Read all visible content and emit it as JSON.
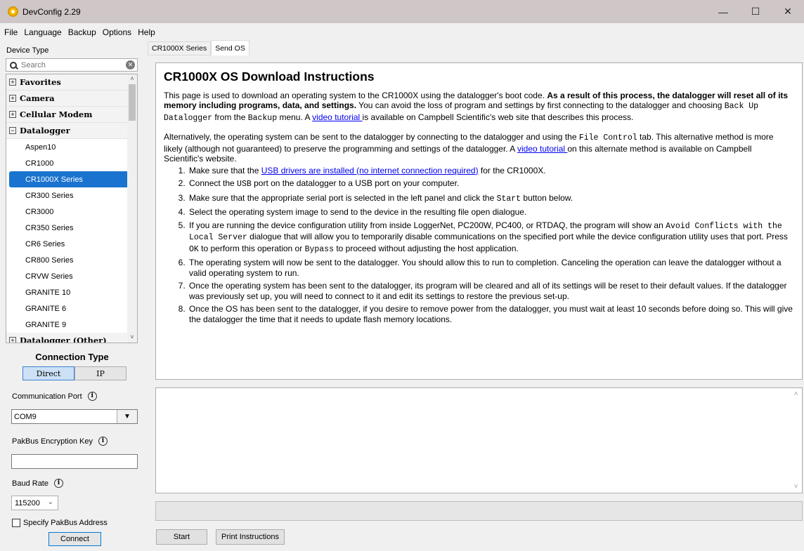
{
  "window": {
    "title": "DevConfig 2.29",
    "min": "—",
    "max": "☐",
    "close": "✕"
  },
  "menu": [
    "File",
    "Language",
    "Backup",
    "Options",
    "Help"
  ],
  "sidebar": {
    "device_type_label": "Device Type",
    "search_placeholder": "Search",
    "tree": [
      {
        "kind": "group",
        "label": "Favorites",
        "expanded": false
      },
      {
        "kind": "group",
        "label": "Camera",
        "expanded": false
      },
      {
        "kind": "group",
        "label": "Cellular Modem",
        "expanded": false
      },
      {
        "kind": "group",
        "label": "Datalogger",
        "expanded": true
      },
      {
        "kind": "child",
        "label": "Aspen10"
      },
      {
        "kind": "child",
        "label": "CR1000"
      },
      {
        "kind": "child",
        "label": "CR1000X Series",
        "selected": true
      },
      {
        "kind": "child",
        "label": "CR300 Series"
      },
      {
        "kind": "child",
        "label": "CR3000"
      },
      {
        "kind": "child",
        "label": "CR350 Series"
      },
      {
        "kind": "child",
        "label": "CR6 Series"
      },
      {
        "kind": "child",
        "label": "CR800 Series"
      },
      {
        "kind": "child",
        "label": "CRVW Series"
      },
      {
        "kind": "child",
        "label": "GRANITE 10"
      },
      {
        "kind": "child",
        "label": "GRANITE 6"
      },
      {
        "kind": "child",
        "label": "GRANITE 9"
      },
      {
        "kind": "group",
        "label": "Datalogger (Other)",
        "expanded": false
      }
    ],
    "connection_type_title": "Connection Type",
    "conn_direct": "Direct",
    "conn_ip": "IP",
    "comm_port_label": "Communication Port",
    "comm_port_value": "COM9",
    "pakbus_key_label": "PakBus Encryption Key",
    "pakbus_key_value": "",
    "baud_label": "Baud Rate",
    "baud_value": "115200",
    "specify_pakbus_label": "Specify PakBus Address",
    "connect_label": "Connect"
  },
  "tabs": [
    "CR1000X Series",
    "Send OS"
  ],
  "instructions": {
    "title": "CR1000X OS Download Instructions",
    "p1_a": "This page is used to download an operating system to the CR1000X using the datalogger's boot code. ",
    "p1_bold": "As a result of this process, the datalogger will reset all of its memory including programs, data, and settings.",
    "p1_b": " You can avoid the loss of program and settings by first connecting to the datalogger and choosing ",
    "p1_mono1": "Back Up Datalogger",
    "p1_c": " from the ",
    "p1_mono2": "Backup",
    "p1_d": " menu. A ",
    "p1_link": "video tutorial ",
    "p1_e": "is available on Campbell Scientific's web site that describes this process.",
    "p2_a": "Alternatively, the operating system can be sent to the datalogger by connecting to the datalogger and using the ",
    "p2_mono": "File Control",
    "p2_b": " tab. This alternative method is more likely (although not guaranteed) to preserve the programming and settings of the datalogger. A ",
    "p2_link": "video tutorial ",
    "p2_c": "on this alternate method is available on Campbell Scientific's website.",
    "s1_a": "Make sure that the ",
    "s1_link": "USB drivers are installed (no internet connection required)",
    "s1_b": " for the CR1000X.",
    "s2_a": "Connect the ",
    "s2_mono": "USB",
    "s2_b": " port on the datalogger to a USB port on your computer.",
    "s3_a": "Make sure that the appropriate serial port is selected in the left panel and click the ",
    "s3_mono": "Start",
    "s3_b": " button below.",
    "s4": "Select the operating system image to send to the device in the resulting file open dialogue.",
    "s5_a": "If you are running the device configuration utility from inside LoggerNet, PC200W, PC400, or RTDAQ, the program will show an ",
    "s5_mono1": "Avoid Conflicts with the Local Server",
    "s5_b": " dialogue that will allow you to temporarily disable communications on the specified port while the device configuration utility uses that port. Press ",
    "s5_mono2": "OK",
    "s5_c": " to perform this operation or ",
    "s5_mono3": "Bypass",
    "s5_d": " to proceed without adjusting the host application.",
    "s6": "The operating system will now be sent to the datalogger. You should allow this to run to completion. Canceling the operation can leave the datalogger without a valid operating system to run.",
    "s7": "Once the operating system has been sent to the datalogger, its program will be cleared and all of its settings will be reset to their default values. If the datalogger was previously set up, you will need to connect to it and edit its settings to restore the previous set-up.",
    "s8": "Once the OS has been sent to the datalogger, if you desire to remove power from the datalogger, you must wait at least 10 seconds before doing so. This will give the datalogger the time that it needs to update flash memory locations."
  },
  "buttons": {
    "start": "Start",
    "print": "Print Instructions"
  }
}
